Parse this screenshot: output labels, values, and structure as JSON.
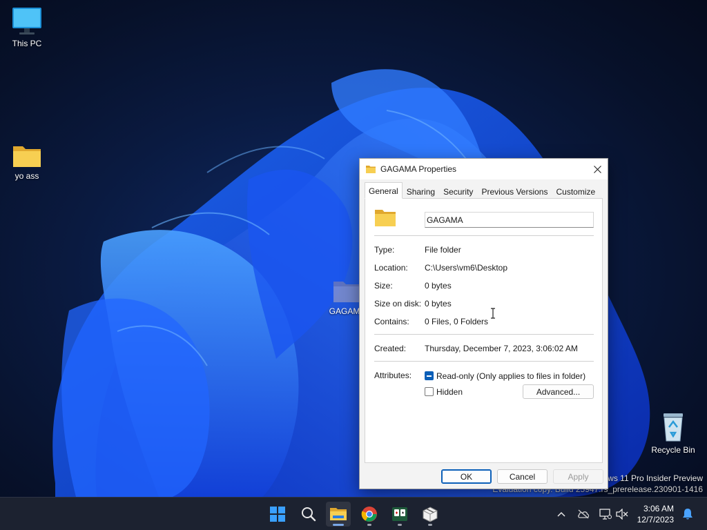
{
  "desktop": {
    "icons": [
      {
        "label": "This PC",
        "icon": "monitor-icon"
      },
      {
        "label": "yo ass",
        "icon": "folder-icon"
      },
      {
        "label": "GAGAMA",
        "icon": "folder-icon"
      },
      {
        "label": "Recycle Bin",
        "icon": "recycle-bin-icon"
      }
    ],
    "watermark": {
      "line1": "ows 11 Pro Insider Preview",
      "line2": "Evaluation copy. Build 25947.rs_prerelease.230901-1416"
    }
  },
  "dialog": {
    "title": "GAGAMA Properties",
    "tabs": [
      "General",
      "Sharing",
      "Security",
      "Previous Versions",
      "Customize"
    ],
    "active_tab": "General",
    "folder_name": "GAGAMA",
    "properties": {
      "type_label": "Type:",
      "type_value": "File folder",
      "location_label": "Location:",
      "location_value": "C:\\Users\\vm6\\Desktop",
      "size_label": "Size:",
      "size_value": "0 bytes",
      "size_on_disk_label": "Size on disk:",
      "size_on_disk_value": "0 bytes",
      "contains_label": "Contains:",
      "contains_value": "0 Files, 0 Folders",
      "created_label": "Created:",
      "created_value": "Thursday, December 7, 2023, 3:06:02 AM",
      "attributes_label": "Attributes:"
    },
    "attributes": {
      "readonly_label": "Read-only (Only applies to files in folder)",
      "readonly_state": "indeterminate",
      "hidden_label": "Hidden",
      "hidden_state": "unchecked",
      "advanced_label": "Advanced..."
    },
    "buttons": {
      "ok": "OK",
      "cancel": "Cancel",
      "apply": "Apply"
    }
  },
  "taskbar": {
    "apps": [
      "start-icon",
      "search-icon",
      "file-explorer-icon",
      "chrome-icon",
      "solitaire-icon",
      "package-icon"
    ],
    "active_app": "file-explorer-icon",
    "tray": [
      "chevron-up-icon",
      "cloud-offline-icon",
      "network-icon",
      "speaker-muted-icon"
    ],
    "clock": {
      "time": "3:06 AM",
      "date": "12/7/2023"
    }
  },
  "colors": {
    "accent": "#0b5fb8",
    "taskbar": "#1c2230",
    "folder": "#f5c542"
  }
}
